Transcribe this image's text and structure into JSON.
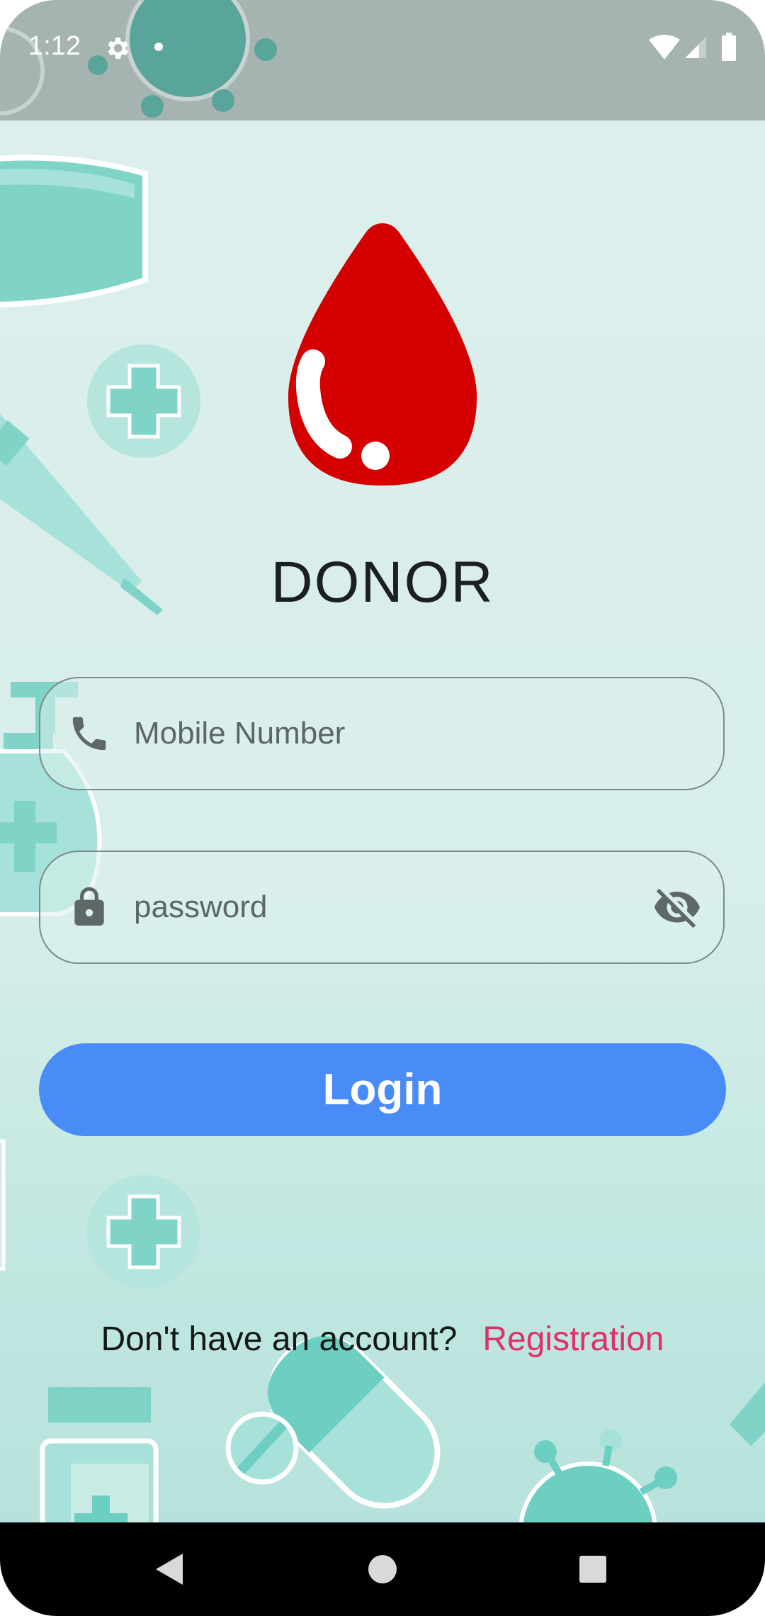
{
  "status_bar": {
    "time": "1:12",
    "icons": [
      "gear-icon",
      "notification-dot-icon",
      "wifi-icon",
      "cell-signal-icon",
      "battery-icon"
    ]
  },
  "app": {
    "title": "DONOR",
    "logo_icon": "blood-drop-icon",
    "logo_color": "#d40000"
  },
  "form": {
    "mobile": {
      "icon": "phone-icon",
      "placeholder": "Mobile Number",
      "value": ""
    },
    "password": {
      "icon": "lock-icon",
      "placeholder": "password",
      "value": "",
      "toggle_icon": "eye-off-icon"
    },
    "login_label": "Login"
  },
  "register": {
    "question": "Don't have an account?",
    "link": "Registration"
  },
  "navigation": {
    "back": "back-icon",
    "home": "home-icon",
    "recents": "recents-icon"
  },
  "colors": {
    "accent": "#4a8cf7",
    "link": "#e0306a",
    "status_bar": "#a5b3b1",
    "background": "#dcefec"
  }
}
